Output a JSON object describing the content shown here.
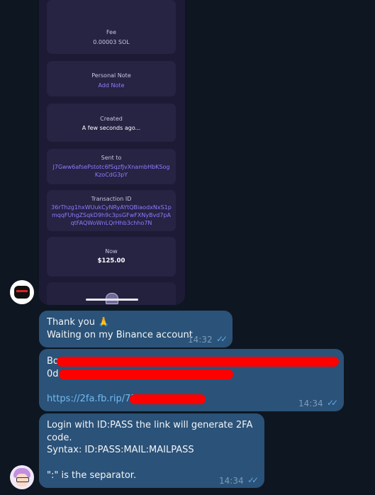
{
  "phone_screen": {
    "fee": {
      "label": "Fee",
      "value": "0.00003 SOL"
    },
    "note": {
      "label": "Personal Note",
      "link": "Add Note"
    },
    "created": {
      "label": "Created",
      "value": "A few seconds ago..."
    },
    "sent_to": {
      "label": "Sent to",
      "value": "J7Gww6afsePstotc6fSqzfJvXnambHbKSogKzoCdG3pY"
    },
    "transaction": {
      "label": "Transaction ID",
      "value": "36rThzg1hxWUukCyNRyAYtQBiaodxNxS1pmqqFUhgZSqkD9h9c3psGFwFXNyBvd7pAqtFAQWoWnLQrHhb3chho7N"
    },
    "now": {
      "label": "Now",
      "value": "$125.00"
    }
  },
  "messages": [
    {
      "line1": "Thank you 🙏",
      "line2": "Waiting on my Binance account",
      "time": "14:32"
    },
    {
      "line1": "Bo",
      "line2": "0d",
      "link": "https://2fa.fb.rip/7R",
      "time": "14:34"
    },
    {
      "line1": "Login with ID:PASS the link will generate 2FA code.",
      "line2": "Syntax: ID:PASS:MAIL:MAILPASS",
      "line3": "\":\" is the separator.",
      "time": "14:34"
    }
  ],
  "colors": {
    "background": "#0e1621",
    "bubble": "#2b5278",
    "link": "#71baf2",
    "redaction": "#ff0000"
  }
}
